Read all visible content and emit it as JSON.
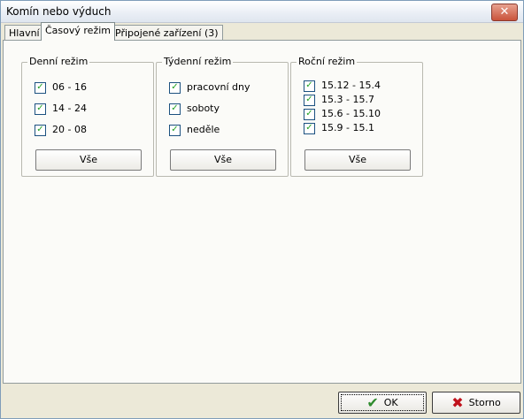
{
  "window": {
    "title": "Komín nebo výduch",
    "close_glyph": "✕"
  },
  "tabs": [
    {
      "label": "Hlavní"
    },
    {
      "label": "Časový režim"
    },
    {
      "label": "Připojené zařízení (3)"
    }
  ],
  "groups": {
    "daily": {
      "title": "Denní režim",
      "items": [
        {
          "label": "06 - 16",
          "checked": true
        },
        {
          "label": "14 - 24",
          "checked": true
        },
        {
          "label": "20 - 08",
          "checked": true
        }
      ],
      "button": "Vše"
    },
    "weekly": {
      "title": "Týdenní režim",
      "items": [
        {
          "label": "pracovní dny",
          "checked": true
        },
        {
          "label": "soboty",
          "checked": true
        },
        {
          "label": "neděle",
          "checked": true
        }
      ],
      "button": "Vše"
    },
    "yearly": {
      "title": "Roční režim",
      "items": [
        {
          "label": "15.12 - 15.4",
          "checked": true
        },
        {
          "label": "15.3 - 15.7",
          "checked": true
        },
        {
          "label": "15.6 - 15.10",
          "checked": true
        },
        {
          "label": "15.9 - 15.1",
          "checked": true
        }
      ],
      "button": "Vše"
    }
  },
  "footer": {
    "ok_label": "OK",
    "cancel_label": "Storno"
  },
  "icons": {
    "check": "✔",
    "cancel": "✖"
  }
}
